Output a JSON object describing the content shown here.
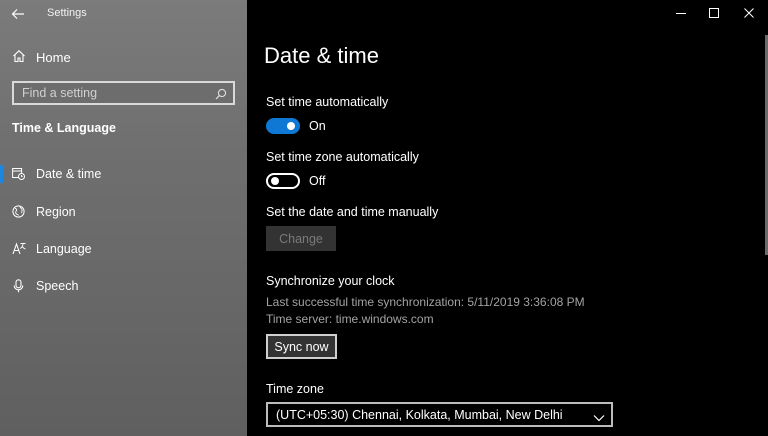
{
  "app": {
    "title": "Settings"
  },
  "sidebar": {
    "home_label": "Home",
    "search_placeholder": "Find a setting",
    "section_title": "Time & Language",
    "items": [
      {
        "label": "Date & time",
        "icon": "calendar-clock-icon",
        "active": true
      },
      {
        "label": "Region",
        "icon": "globe-icon",
        "active": false
      },
      {
        "label": "Language",
        "icon": "language-icon",
        "active": false
      },
      {
        "label": "Speech",
        "icon": "microphone-icon",
        "active": false
      }
    ],
    "active_accent": "#1f86e0"
  },
  "main": {
    "title": "Date & time",
    "set_time_auto": {
      "label": "Set time automatically",
      "state": "On",
      "on": true
    },
    "set_tz_auto": {
      "label": "Set time zone automatically",
      "state": "Off",
      "on": false
    },
    "manual": {
      "label": "Set the date and time manually",
      "button": "Change"
    },
    "sync": {
      "heading": "Synchronize your clock",
      "last_sync": "Last successful time synchronization: 5/11/2019 3:36:08 PM",
      "server": "Time server: time.windows.com",
      "button": "Sync now"
    },
    "timezone": {
      "label": "Time zone",
      "value": "(UTC+05:30) Chennai, Kolkata, Mumbai, New Delhi"
    }
  },
  "colors": {
    "accent": "#0f78d4",
    "background": "#000000"
  }
}
